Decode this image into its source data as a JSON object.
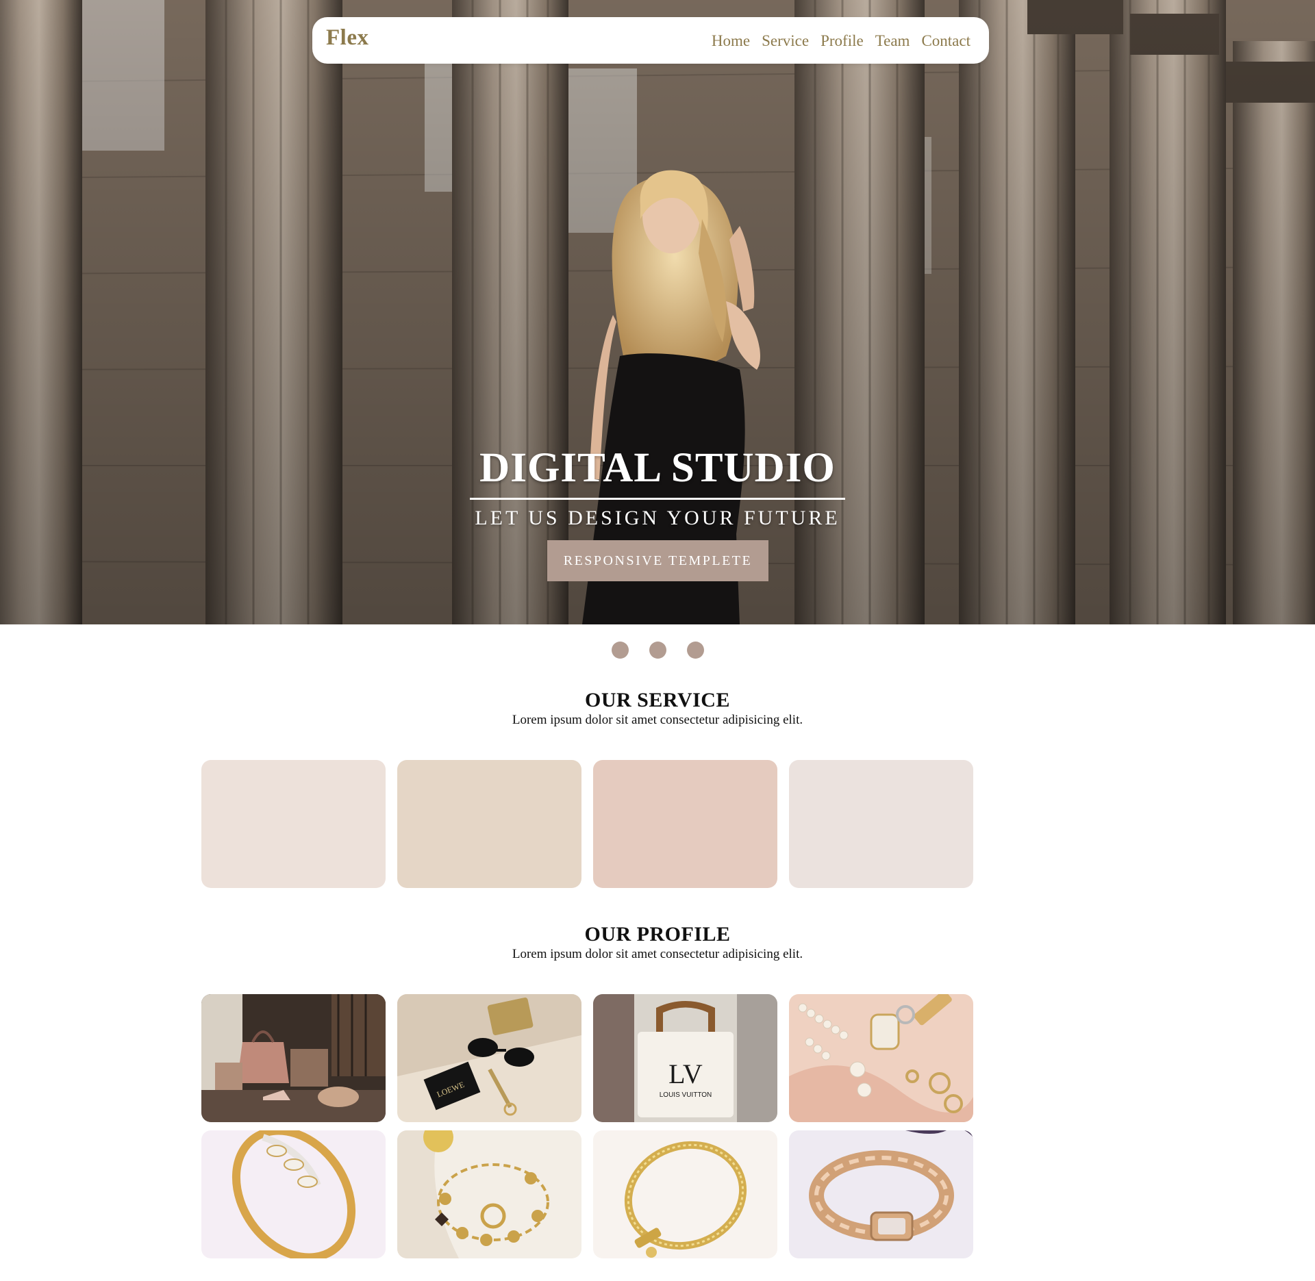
{
  "nav": {
    "brand": "Flex",
    "links": [
      "Home",
      "Service",
      "Profile",
      "Team",
      "Contact"
    ]
  },
  "hero": {
    "title": "DIGITAL STUDIO",
    "subtitle": "LET US DESIGN YOUR FUTURE",
    "button_label": "RESPONSIVE TEMPLETE"
  },
  "slider": {
    "dot_count": 3
  },
  "service": {
    "title": "OUR SERVICE",
    "subtitle": "Lorem ipsum dolor sit amet consectetur adipisicing elit.",
    "card_colors": [
      "#ede1da",
      "#e5d6c6",
      "#e5cbbf",
      "#ebe2de"
    ]
  },
  "profile": {
    "title": "OUR PROFILE",
    "subtitle": "Lorem ipsum dolor sit amet consectetur adipisicing elit.",
    "thumbnail_labels": [
      "LOEWE",
      "LV",
      "LOUIS VUITTON"
    ]
  },
  "colors": {
    "accent": "#8c7a4c",
    "button": "#b29c91",
    "heading": "#111111"
  }
}
